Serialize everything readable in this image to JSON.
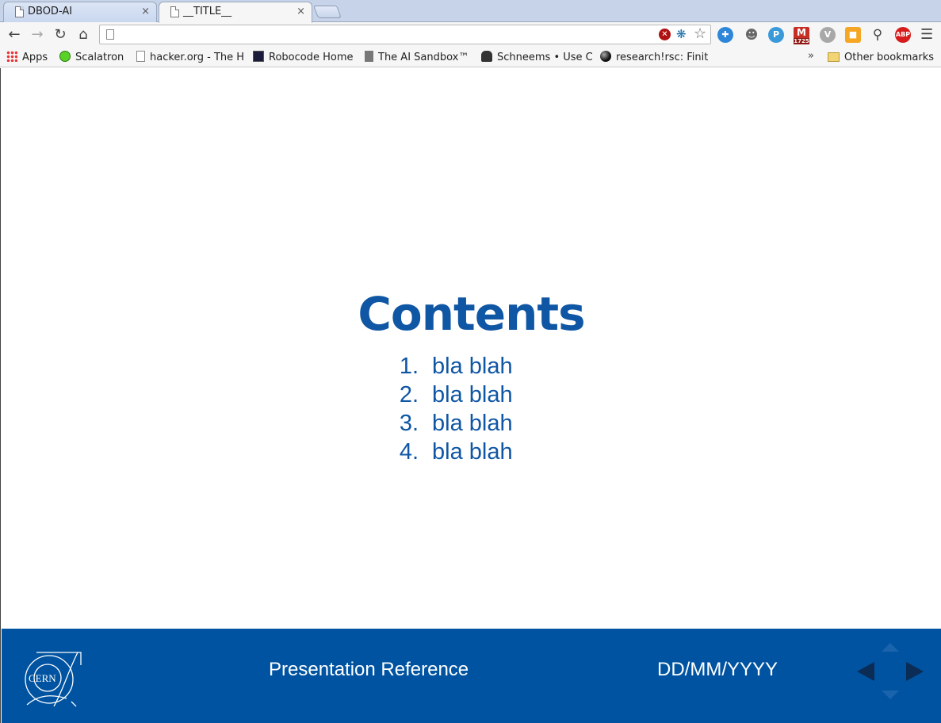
{
  "browser": {
    "tabs": [
      {
        "title": "DBOD-AI",
        "close": "×"
      },
      {
        "title": "__TITLE__",
        "close": "×"
      }
    ],
    "address": {
      "value": "",
      "placeholder": ""
    },
    "extensions": {
      "p_label": "P",
      "gmail_count": "1725",
      "v_label": "V",
      "abp_label": "ABP"
    },
    "bookmarks": [
      {
        "label": "Apps"
      },
      {
        "label": "Scalatron"
      },
      {
        "label": "hacker.org - The H"
      },
      {
        "label": "Robocode Home"
      },
      {
        "label": "The AI Sandbox™"
      },
      {
        "label": "Schneems • Use C"
      },
      {
        "label": "research!rsc: Finit"
      }
    ],
    "more_bookmarks": "»",
    "other_bookmarks": "Other bookmarks"
  },
  "slide": {
    "title": "Contents",
    "items": [
      {
        "num": "1.",
        "text": "bla blah"
      },
      {
        "num": "2.",
        "text": "bla blah"
      },
      {
        "num": "3.",
        "text": "bla blah"
      },
      {
        "num": "4.",
        "text": "bla blah"
      }
    ],
    "footer": {
      "logo_text": "CERN",
      "reference": "Presentation Reference",
      "date": "DD/MM/YYYY"
    }
  },
  "colors": {
    "accent": "#0f56a4",
    "footer_bg": "#0053a1"
  }
}
